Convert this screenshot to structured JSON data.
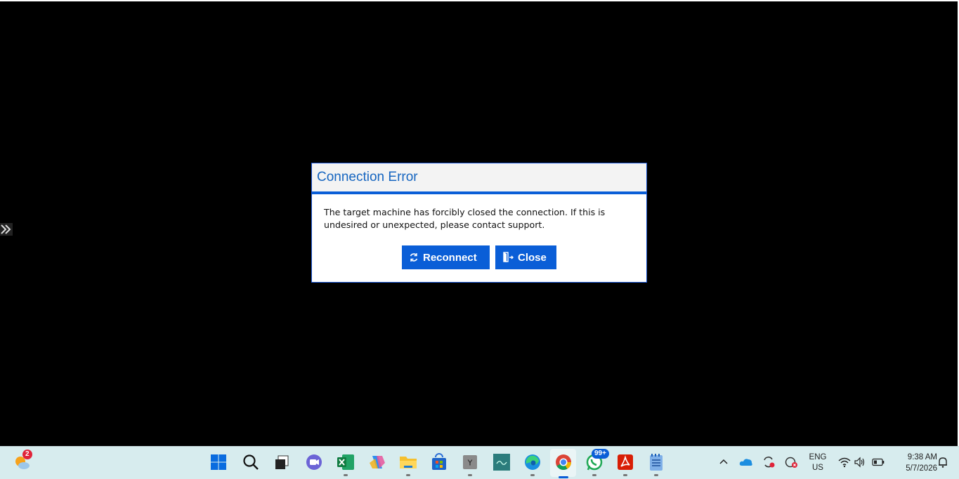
{
  "dialog": {
    "title": "Connection Error",
    "message": "The target machine has forcibly closed the connection. If this is undesired or unexpected, please contact support.",
    "reconnect_label": "Reconnect",
    "close_label": "Close"
  },
  "taskbar": {
    "weather_badge": "2",
    "whatsapp_badge": "99+",
    "language_line1": "ENG",
    "language_line2": "US",
    "time": "9:38 AM",
    "date": "5/7/2026"
  },
  "colors": {
    "accent": "#0a5ed7",
    "title": "#1565c0",
    "taskbar": "#d7ecee"
  },
  "icons": [
    "weather-icon",
    "start-icon",
    "search-icon",
    "task-view-icon",
    "teams-icon",
    "excel-icon",
    "copilot-icon",
    "file-explorer-icon",
    "store-icon",
    "app-y-icon",
    "arabic-app-icon",
    "edge-icon",
    "chrome-icon",
    "whatsapp-icon",
    "acrobat-icon",
    "notepad-icon",
    "chevron-up-icon",
    "onedrive-icon",
    "sync-icon",
    "security-icon",
    "wifi-icon",
    "volume-icon",
    "battery-icon",
    "notification-icon"
  ]
}
